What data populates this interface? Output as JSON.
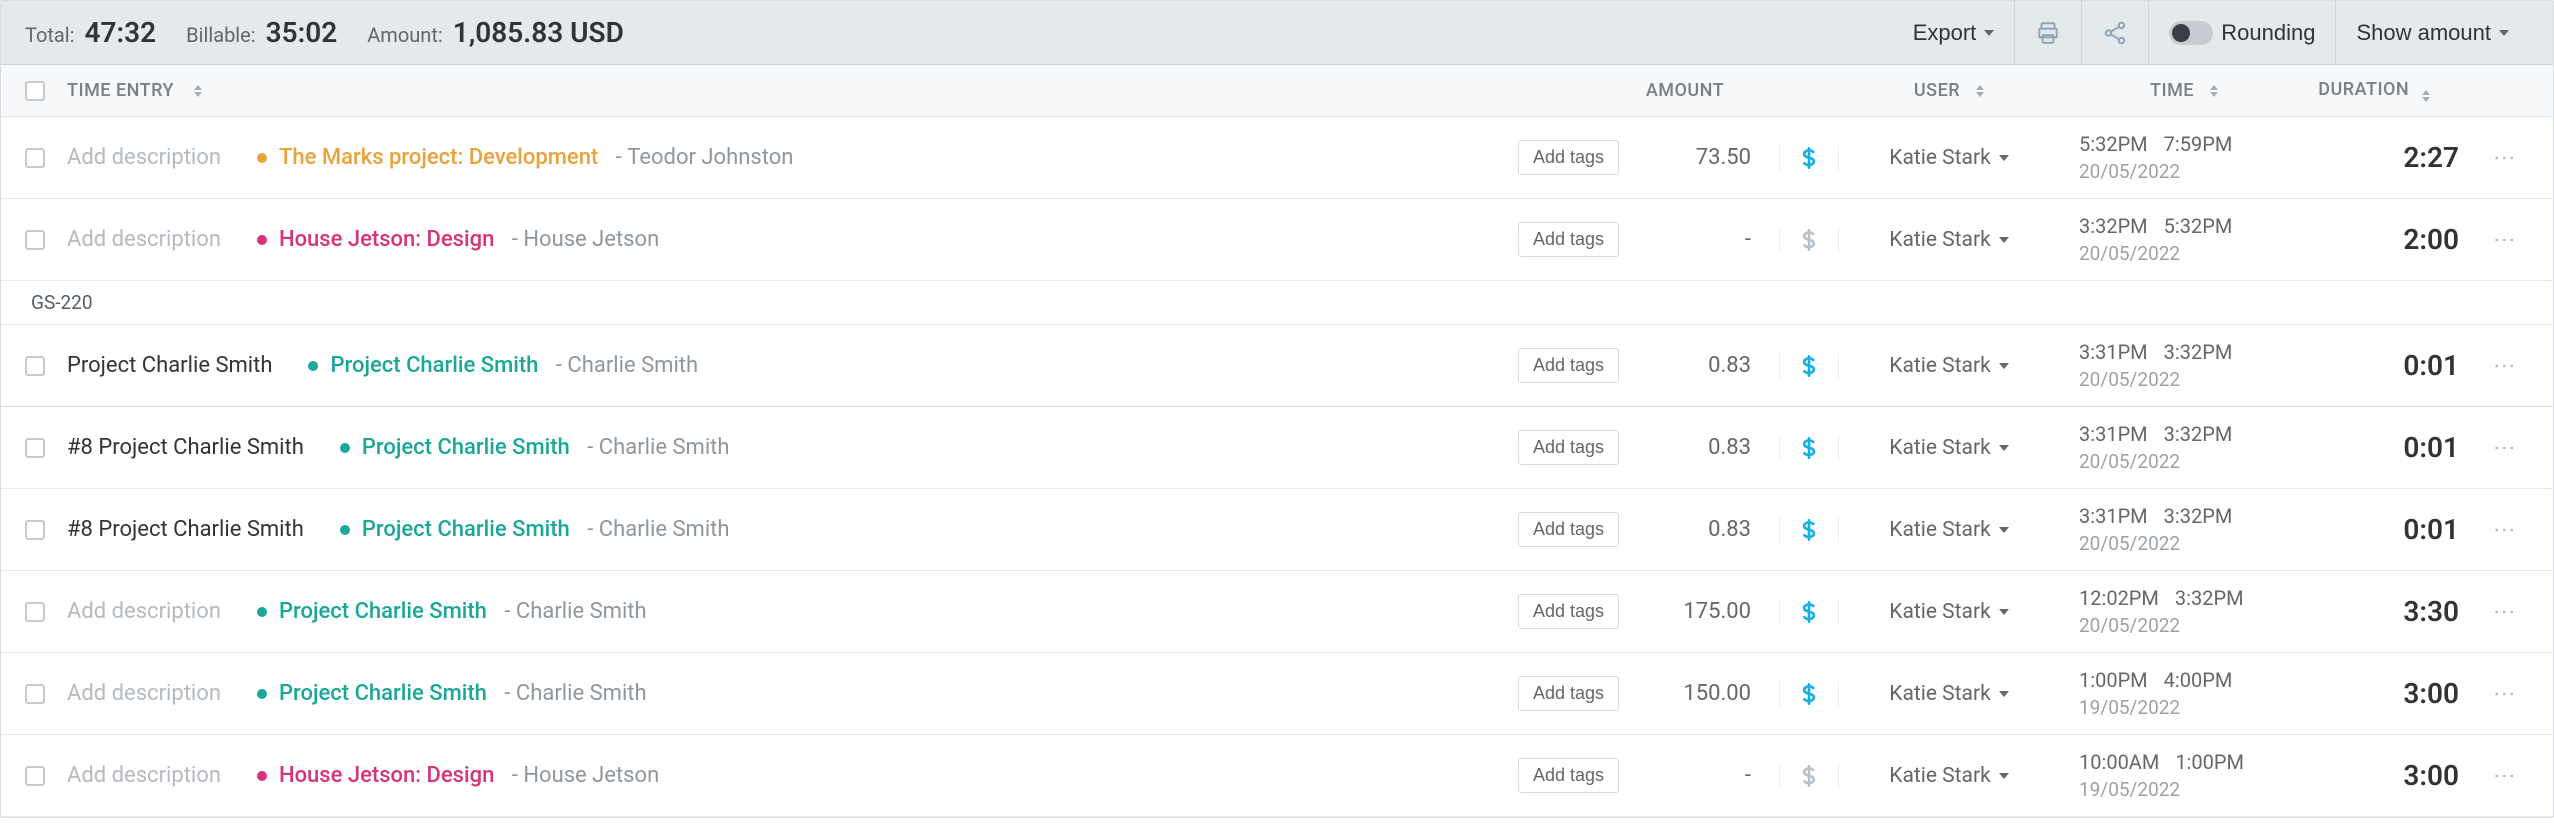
{
  "topbar": {
    "total_label": "Total:",
    "total_value": "47:32",
    "billable_label": "Billable:",
    "billable_value": "35:02",
    "amount_label": "Amount:",
    "amount_value": "1,085.83 USD",
    "export_label": "Export",
    "rounding_label": "Rounding",
    "show_amount_label": "Show amount"
  },
  "headers": {
    "time_entry": "TIME ENTRY",
    "amount": "AMOUNT",
    "user": "USER",
    "time": "TIME",
    "duration": "DURATION"
  },
  "groups": [
    {
      "title": "GS-220"
    }
  ],
  "colors": {
    "orange": "#e8a23a",
    "magenta": "#d6337c",
    "teal": "#1aa698"
  },
  "rows": [
    {
      "description": "",
      "desc_placeholder": "Add description",
      "project": "The Marks project: Development",
      "project_color": "orange",
      "client": "Teodor Johnston",
      "tags_label": "Add tags",
      "amount": "73.50",
      "billable": true,
      "user": "Katie Stark",
      "start": "5:32PM",
      "end": "7:59PM",
      "date": "20/05/2022",
      "duration": "2:27",
      "group_after": false
    },
    {
      "description": "",
      "desc_placeholder": "Add description",
      "project": "House Jetson: Design",
      "project_color": "magenta",
      "client": "House Jetson",
      "tags_label": "Add tags",
      "amount": "-",
      "billable": false,
      "user": "Katie Stark",
      "start": "3:32PM",
      "end": "5:32PM",
      "date": "20/05/2022",
      "duration": "2:00",
      "group_after": true
    },
    {
      "description": "Project Charlie Smith",
      "desc_placeholder": "",
      "project": "Project Charlie Smith",
      "project_color": "teal",
      "client": "Charlie Smith",
      "tags_label": "Add tags",
      "amount": "0.83",
      "billable": true,
      "user": "Katie Stark",
      "start": "3:31PM",
      "end": "3:32PM",
      "date": "20/05/2022",
      "duration": "0:01",
      "group_after": false,
      "emph": true
    },
    {
      "description": "#8 Project Charlie Smith",
      "desc_placeholder": "",
      "project": "Project Charlie Smith",
      "project_color": "teal",
      "client": "Charlie Smith",
      "tags_label": "Add tags",
      "amount": "0.83",
      "billable": true,
      "user": "Katie Stark",
      "start": "3:31PM",
      "end": "3:32PM",
      "date": "20/05/2022",
      "duration": "0:01",
      "group_after": false
    },
    {
      "description": "#8 Project Charlie Smith",
      "desc_placeholder": "",
      "project": "Project Charlie Smith",
      "project_color": "teal",
      "client": "Charlie Smith",
      "tags_label": "Add tags",
      "amount": "0.83",
      "billable": true,
      "user": "Katie Stark",
      "start": "3:31PM",
      "end": "3:32PM",
      "date": "20/05/2022",
      "duration": "0:01",
      "group_after": false
    },
    {
      "description": "",
      "desc_placeholder": "Add description",
      "project": "Project Charlie Smith",
      "project_color": "teal",
      "client": "Charlie Smith",
      "tags_label": "Add tags",
      "amount": "175.00",
      "billable": true,
      "user": "Katie Stark",
      "start": "12:02PM",
      "end": "3:32PM",
      "date": "20/05/2022",
      "duration": "3:30",
      "group_after": false
    },
    {
      "description": "",
      "desc_placeholder": "Add description",
      "project": "Project Charlie Smith",
      "project_color": "teal",
      "client": "Charlie Smith",
      "tags_label": "Add tags",
      "amount": "150.00",
      "billable": true,
      "user": "Katie Stark",
      "start": "1:00PM",
      "end": "4:00PM",
      "date": "19/05/2022",
      "duration": "3:00",
      "group_after": false
    },
    {
      "description": "",
      "desc_placeholder": "Add description",
      "project": "House Jetson: Design",
      "project_color": "magenta",
      "client": "House Jetson",
      "tags_label": "Add tags",
      "amount": "-",
      "billable": false,
      "user": "Katie Stark",
      "start": "10:00AM",
      "end": "1:00PM",
      "date": "19/05/2022",
      "duration": "3:00",
      "group_after": false
    }
  ]
}
